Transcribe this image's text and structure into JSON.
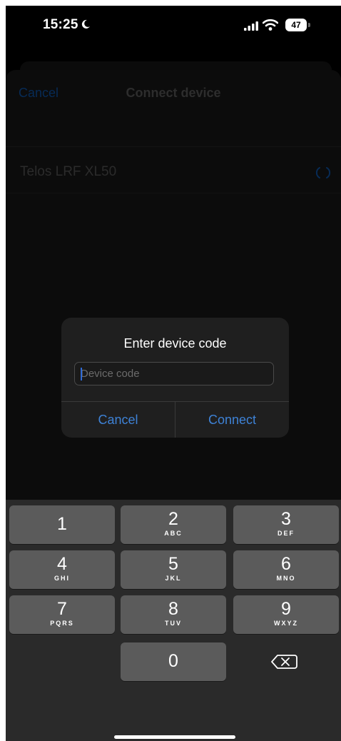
{
  "status_bar": {
    "time": "15:25",
    "battery": "47"
  },
  "nav": {
    "cancel_label": "Cancel",
    "title": "Connect device"
  },
  "device_list": [
    {
      "name": "Telos LRF XL50"
    }
  ],
  "alert": {
    "title": "Enter device code",
    "input_placeholder": "Device code",
    "input_value": "",
    "cancel_label": "Cancel",
    "connect_label": "Connect"
  },
  "keypad": {
    "keys": [
      {
        "digit": "1",
        "letters": ""
      },
      {
        "digit": "2",
        "letters": "ABC"
      },
      {
        "digit": "3",
        "letters": "DEF"
      },
      {
        "digit": "4",
        "letters": "GHI"
      },
      {
        "digit": "5",
        "letters": "JKL"
      },
      {
        "digit": "6",
        "letters": "MNO"
      },
      {
        "digit": "7",
        "letters": "PQRS"
      },
      {
        "digit": "8",
        "letters": "TUV"
      },
      {
        "digit": "9",
        "letters": "WXYZ"
      },
      {
        "digit": "0",
        "letters": ""
      }
    ],
    "delete_icon": "backspace-icon"
  },
  "colors": {
    "accent": "#3e82d6",
    "key": "#5b5b5b",
    "keyboard_bg": "#2a2a2a",
    "alert_bg": "#1f1f1f"
  }
}
